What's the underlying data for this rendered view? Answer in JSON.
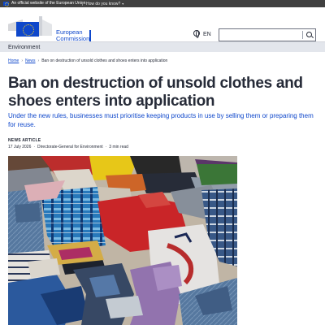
{
  "eu_bar": {
    "official_text": "An official website of the European Union",
    "how_label": "How do you know?"
  },
  "header": {
    "logo_line1": "European",
    "logo_line2": "Commission",
    "language": "EN",
    "search_placeholder": ""
  },
  "section": {
    "title": "Environment"
  },
  "breadcrumb": {
    "items": [
      "Home",
      "News",
      "Ban on destruction of unsold clothes and shoes enters into application"
    ]
  },
  "article": {
    "title": "Ban on destruction of unsold clothes and shoes enters into application",
    "summary": "Under the new rules, businesses must prioritise keeping products in use by selling them or preparing them for reuse.",
    "type": "NEWS ARTICLE",
    "date": "17 July 2026",
    "author": "Directorate-General for Environment",
    "read_time": "3 min read"
  },
  "colors": {
    "eu_blue": "#0e47cb",
    "eu_yellow": "#ffd617",
    "top_bar": "#404040",
    "section_bar": "#e3e6ec"
  }
}
